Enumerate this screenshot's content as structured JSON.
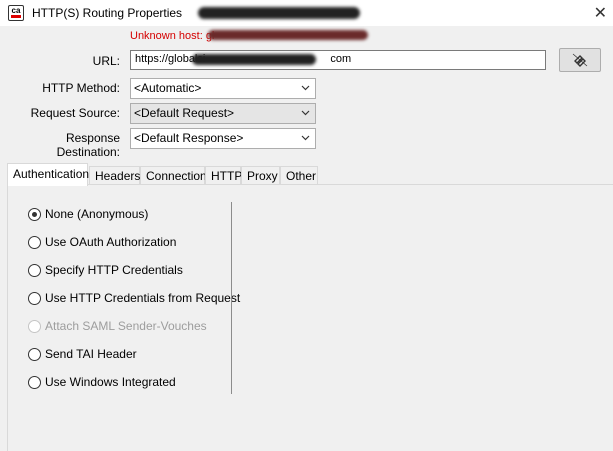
{
  "window": {
    "title": "HTTP(S) Routing Properties",
    "logo_text": "ca"
  },
  "error_message": "Unknown host: gl",
  "form": {
    "url_label": "URL:",
    "url_value": "https://globalsi",
    "url_value_tail": "com",
    "http_method_label": "HTTP Method:",
    "http_method_value": "<Automatic>",
    "request_source_label": "Request Source:",
    "request_source_value": "<Default Request>",
    "response_destination_label": "Response Destination:",
    "response_destination_value": "<Default Response>"
  },
  "tabs": [
    {
      "label": "Authentication",
      "active": true
    },
    {
      "label": "Headers",
      "active": false
    },
    {
      "label": "Connection",
      "active": false
    },
    {
      "label": "HTTP",
      "active": false
    },
    {
      "label": "Proxy",
      "active": false
    },
    {
      "label": "Other",
      "active": false
    }
  ],
  "auth_options": [
    {
      "label": "None (Anonymous)",
      "checked": true,
      "enabled": true
    },
    {
      "label": "Use OAuth Authorization",
      "checked": false,
      "enabled": true
    },
    {
      "label": "Specify HTTP Credentials",
      "checked": false,
      "enabled": true
    },
    {
      "label": "Use HTTP Credentials from Request",
      "checked": false,
      "enabled": true
    },
    {
      "label": "Attach SAML Sender-Vouches",
      "checked": false,
      "enabled": false
    },
    {
      "label": "Send TAI Header",
      "checked": false,
      "enabled": true
    },
    {
      "label": "Use Windows Integrated",
      "checked": false,
      "enabled": true
    }
  ],
  "icons": {
    "url_button": "link-resolve-icon",
    "close": "close-icon",
    "dropdown": "chevron-down-icon"
  },
  "colors": {
    "error": "#d40000",
    "background": "#f0f0f0"
  }
}
